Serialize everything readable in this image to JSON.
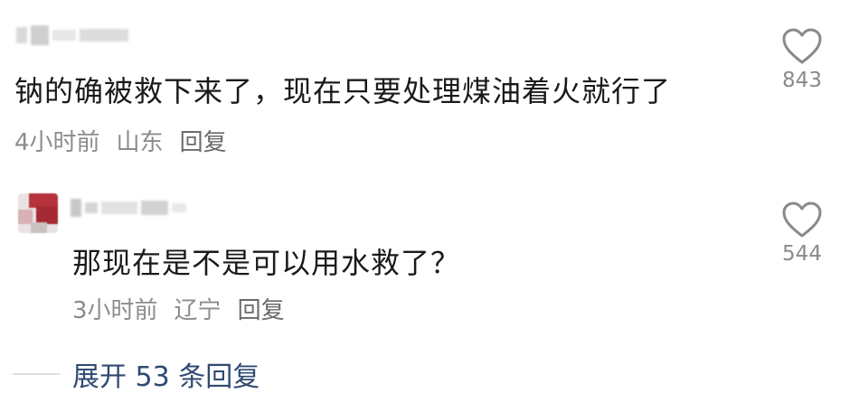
{
  "comments": [
    {
      "text": "钠的确被救下来了，现在只要处理煤油着火就行了",
      "time": "4小时前",
      "location": "山东",
      "reply_label": "回复",
      "likes": "843"
    },
    {
      "text": "那现在是不是可以用水救了？",
      "time": "3小时前",
      "location": "辽宁",
      "reply_label": "回复",
      "likes": "544"
    }
  ],
  "expand_replies": "展开 53 条回复",
  "colors": {
    "body_text": "#1a1a1a",
    "meta_text": "#8c8c8c",
    "expand_text": "#2f4a72",
    "like_icon": "#8a8a8a"
  },
  "icons": {
    "like": "heart-outline-icon"
  }
}
